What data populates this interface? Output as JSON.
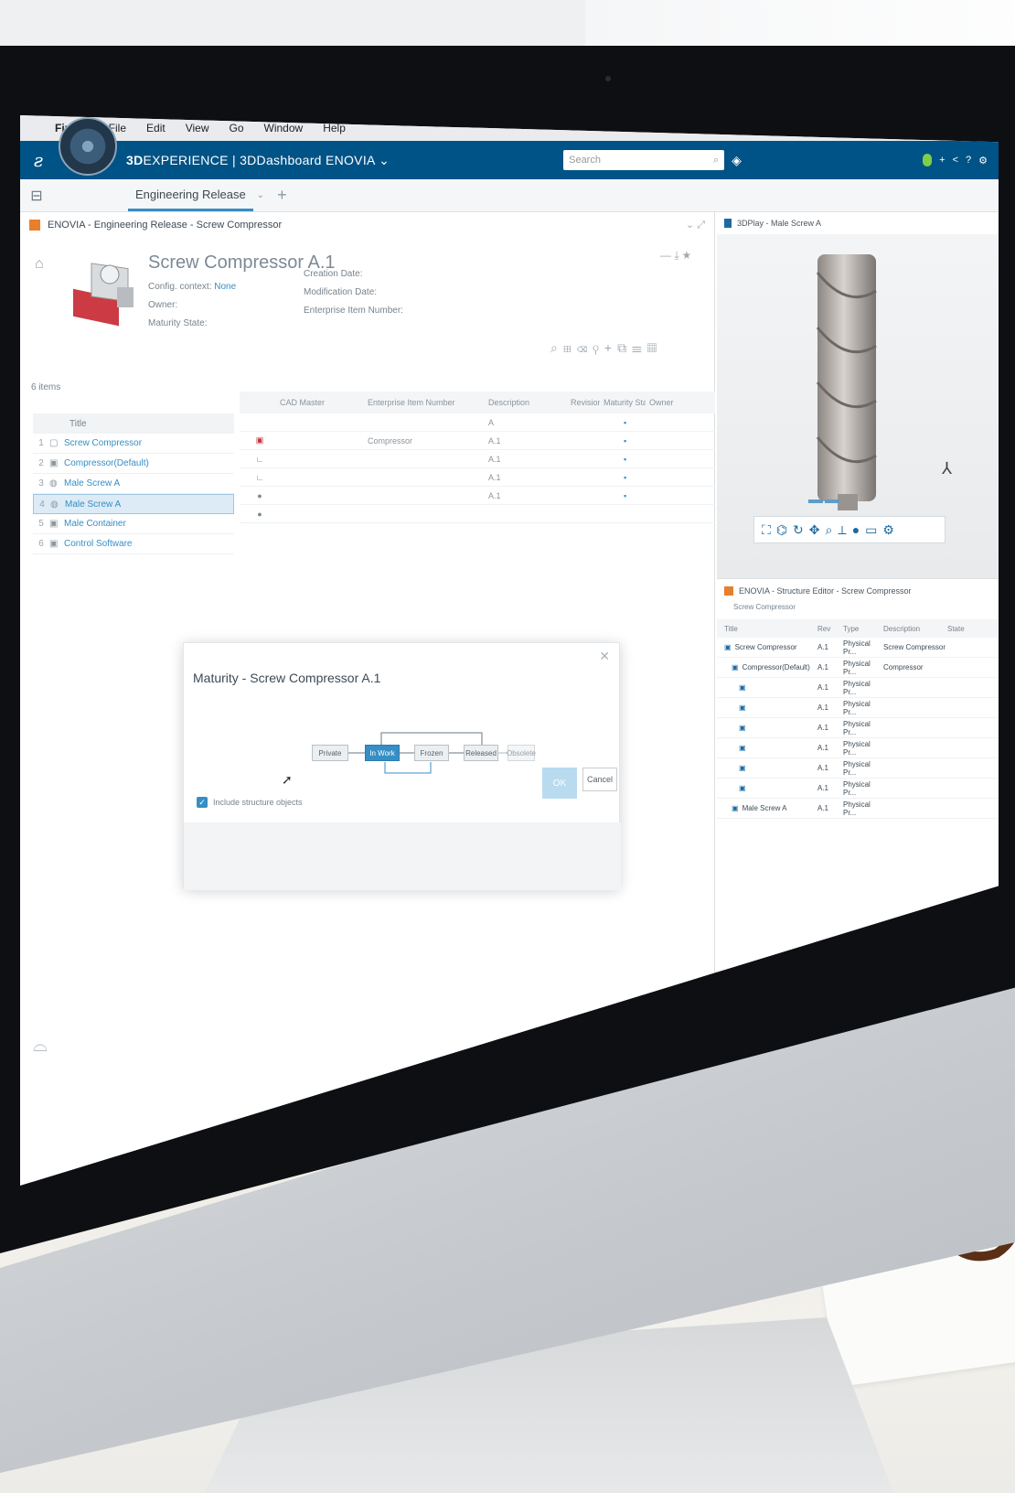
{
  "mac_menu": {
    "items": [
      "Finder",
      "File",
      "Edit",
      "View",
      "Go",
      "Window",
      "Help"
    ]
  },
  "topbar": {
    "brand_prefix": "3D",
    "brand_rest": "EXPERIENCE | 3DDashboard ENOVIA",
    "search_placeholder": "Search",
    "icons": [
      "ds-logo-icon",
      "compass-icon",
      "tag-icon",
      "user-icon",
      "share-icon",
      "help-icon"
    ]
  },
  "tabs": {
    "active": "Engineering Release"
  },
  "widget_main": {
    "title": "ENOVIA - Engineering Release - Screw Compressor",
    "object_title": "Screw Compressor A.1",
    "meta": {
      "config_label": "Config. context:",
      "config_value": "None",
      "owner_label": "Owner:",
      "maturity_label": "Maturity State:",
      "creation_label": "Creation Date:",
      "modification_label": "Modification Date:",
      "enterprise_label": "Enterprise Item Number:"
    },
    "items_count": "6 items",
    "tree": {
      "header": "Title",
      "rows": [
        {
          "num": "1",
          "label": "Screw Compressor"
        },
        {
          "num": "2",
          "label": "Compressor(Default)"
        },
        {
          "num": "3",
          "label": "Male Screw A"
        },
        {
          "num": "4",
          "label": "Male Screw A"
        },
        {
          "num": "5",
          "label": "Male Container"
        },
        {
          "num": "6",
          "label": "Control Software"
        }
      ]
    },
    "grid": {
      "headers": [
        "",
        "CAD Master",
        "Enterprise Item Number",
        "Description",
        "Revision",
        "Maturity State",
        "Owner",
        "",
        ""
      ],
      "rows": [
        {
          "name": "",
          "desc": "",
          "rev": "A",
          "state": "",
          "owner": ""
        },
        {
          "name": "",
          "desc": "Compressor",
          "rev": "A.1",
          "state": "",
          "owner": ""
        },
        {
          "name": "",
          "desc": "",
          "rev": "A.1",
          "state": "",
          "owner": ""
        },
        {
          "name": "",
          "desc": "",
          "rev": "A.1",
          "state": "",
          "owner": ""
        },
        {
          "name": "",
          "desc": "",
          "rev": "A.1",
          "state": "",
          "owner": ""
        },
        {
          "name": "",
          "desc": "",
          "rev": "",
          "state": "",
          "owner": ""
        }
      ]
    }
  },
  "dialog": {
    "title": "Maturity - Screw Compressor A.1",
    "states": [
      "Private",
      "In Work",
      "Frozen",
      "Released",
      "Obsolete"
    ],
    "active_state": "In Work",
    "include_label": "Include structure objects",
    "ok_label": "OK",
    "cancel_label": "Cancel"
  },
  "viewer": {
    "title": "3DPlay - Male Screw A",
    "view_tabs": [
      "",
      ""
    ]
  },
  "structure": {
    "title": "ENOVIA - Structure Editor - Screw Compressor",
    "breadcrumb": "Screw Compressor",
    "columns": [
      "Title",
      "Rev",
      "Type",
      "Description",
      "State"
    ],
    "rows": [
      {
        "title": "Screw Compressor",
        "rev": "A.1",
        "type": "Physical Pr...",
        "desc": "Screw Compressor",
        "state": ""
      },
      {
        "title": "Compressor(Default)",
        "rev": "A.1",
        "type": "Physical Pr...",
        "desc": "Compressor",
        "state": ""
      },
      {
        "title": "",
        "rev": "A.1",
        "type": "Physical Pr...",
        "desc": "",
        "state": ""
      },
      {
        "title": "",
        "rev": "A.1",
        "type": "Physical Pr...",
        "desc": "",
        "state": ""
      },
      {
        "title": "",
        "rev": "A.1",
        "type": "Physical Pr...",
        "desc": "",
        "state": ""
      },
      {
        "title": "",
        "rev": "A.1",
        "type": "Physical Pr...",
        "desc": "",
        "state": ""
      },
      {
        "title": "",
        "rev": "A.1",
        "type": "Physical Pr...",
        "desc": "",
        "state": ""
      },
      {
        "title": "",
        "rev": "A.1",
        "type": "Physical Pr...",
        "desc": "",
        "state": ""
      },
      {
        "title": "Male Screw A",
        "rev": "A.1",
        "type": "Physical Pr...",
        "desc": "",
        "state": ""
      }
    ]
  },
  "colors": {
    "topbar": "#005386",
    "accent": "#368ec4",
    "orange": "#e87f2b"
  }
}
